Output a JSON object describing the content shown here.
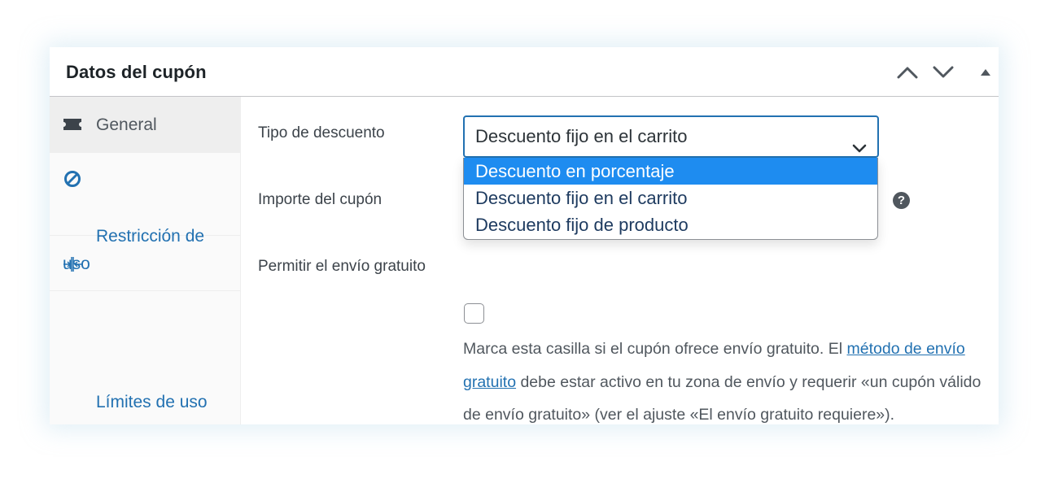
{
  "panel": {
    "title": "Datos del cupón"
  },
  "header_buttons": {
    "move_up": "chevron-up-icon",
    "move_down": "chevron-down-icon",
    "toggle": "triangle-up-icon"
  },
  "tabs": [
    {
      "label": "General",
      "icon": "ticket-icon",
      "active": true
    },
    {
      "label": "Restricción de uso",
      "icon": "no-entry-icon",
      "active": false
    },
    {
      "label": "Límites de uso",
      "icon": "arrows-in-icon",
      "active": false
    }
  ],
  "form": {
    "discount_type": {
      "label": "Tipo de descuento",
      "value": "Descuento fijo en el carrito",
      "options": [
        "Descuento en porcentaje",
        "Descuento fijo en el carrito",
        "Descuento fijo de producto"
      ],
      "highlighted_option": "Descuento en porcentaje"
    },
    "amount": {
      "label": "Importe del cupón",
      "help": "?"
    },
    "free_shipping": {
      "label": "Permitir el envío gratuito",
      "checked": false,
      "desc_before": "Marca esta casilla si el cupón ofrece envío gratuito. El ",
      "link": "método de envío gratuito",
      "desc_after": " debe estar activo en tu zona de envío y requerir «un cupón válido de envío gratuito» (ver el ajuste «El envío gratuito requiere»)."
    }
  },
  "colors": {
    "accent": "#2271b1",
    "highlight": "#1e8cf0",
    "border": "#c3c4c7"
  }
}
